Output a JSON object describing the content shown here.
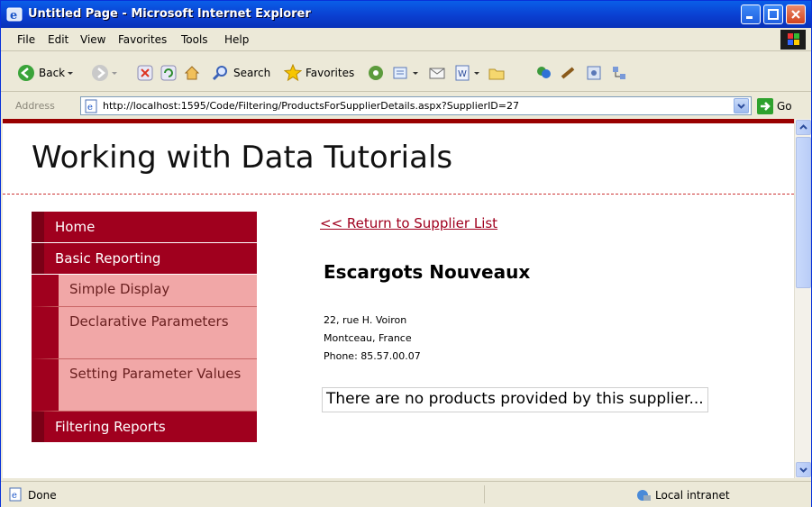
{
  "window": {
    "title": "Untitled Page - Microsoft Internet Explorer"
  },
  "menubar": {
    "items": [
      "File",
      "Edit",
      "View",
      "Favorites",
      "Tools",
      "Help"
    ]
  },
  "toolbar": {
    "back_label": "Back",
    "search_label": "Search",
    "favorites_label": "Favorites"
  },
  "address": {
    "label": "Address",
    "url": "http://localhost:1595/Code/Filtering/ProductsForSupplierDetails.aspx?SupplierID=27",
    "go_label": "Go"
  },
  "page": {
    "site_title": "Working with Data Tutorials",
    "menu": {
      "home": "Home",
      "basic_reporting": "Basic Reporting",
      "simple_display": "Simple Display",
      "declarative_parameters": "Declarative Parameters",
      "setting_parameter_values": "Setting Parameter Values",
      "filtering_reports": "Filtering Reports"
    },
    "return_link": "<< Return to Supplier List",
    "supplier": {
      "name": "Escargots Nouveaux",
      "address": "22, rue H. Voiron",
      "city_country": "Montceau, France",
      "phone": "Phone: 85.57.00.07"
    },
    "empty_message": "There are no products provided by this supplier..."
  },
  "status": {
    "text": "Done",
    "zone": "Local intranet"
  },
  "colors": {
    "menu_dark": "#a0001e",
    "menu_light": "#f1a7a7",
    "header_border": "#990000",
    "xp_blue": "#0a3fd1"
  }
}
